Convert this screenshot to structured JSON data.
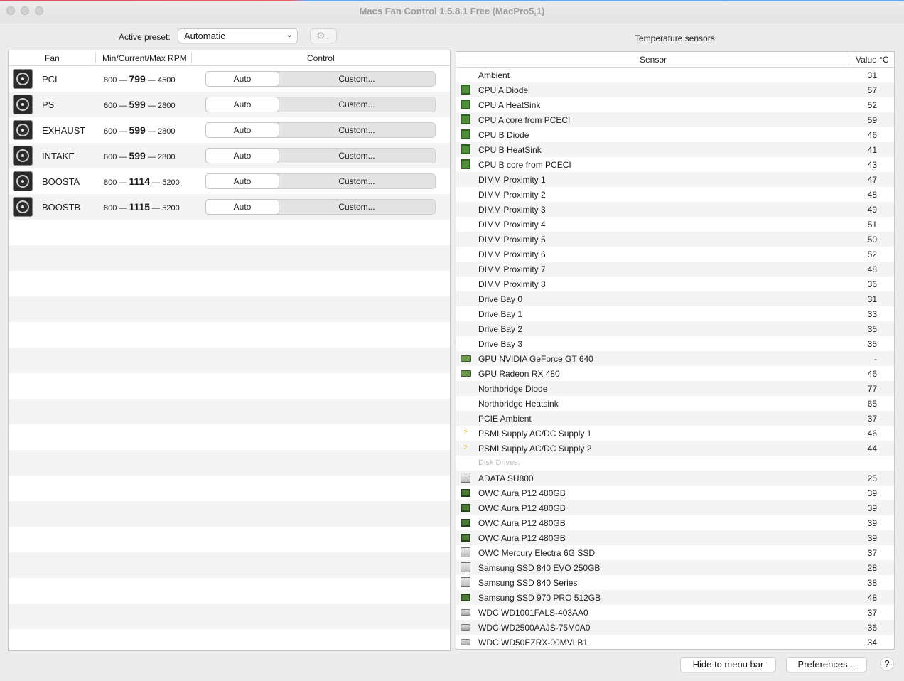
{
  "window": {
    "title": "Macs Fan Control 1.5.8.1 Free (MacPro5,1)"
  },
  "preset": {
    "label": "Active preset:",
    "value": "Automatic"
  },
  "fans_table": {
    "headers": {
      "fan": "Fan",
      "rpm": "Min/Current/Max RPM",
      "control": "Control"
    },
    "rows": [
      {
        "name": "PCI",
        "min": "800",
        "current": "799",
        "max": "4500",
        "auto": "Auto",
        "custom": "Custom..."
      },
      {
        "name": "PS",
        "min": "600",
        "current": "599",
        "max": "2800",
        "auto": "Auto",
        "custom": "Custom..."
      },
      {
        "name": "EXHAUST",
        "min": "600",
        "current": "599",
        "max": "2800",
        "auto": "Auto",
        "custom": "Custom..."
      },
      {
        "name": "INTAKE",
        "min": "600",
        "current": "599",
        "max": "2800",
        "auto": "Auto",
        "custom": "Custom..."
      },
      {
        "name": "BOOSTA",
        "min": "800",
        "current": "1114",
        "max": "5200",
        "auto": "Auto",
        "custom": "Custom..."
      },
      {
        "name": "BOOSTB",
        "min": "800",
        "current": "1115",
        "max": "5200",
        "auto": "Auto",
        "custom": "Custom..."
      }
    ]
  },
  "sensors": {
    "title": "Temperature sensors:",
    "headers": {
      "sensor": "Sensor",
      "value": "Value °C"
    },
    "rows": [
      {
        "name": "Ambient",
        "value": "31",
        "icon": "none"
      },
      {
        "name": "CPU A Diode",
        "value": "57",
        "icon": "chip"
      },
      {
        "name": "CPU A HeatSink",
        "value": "52",
        "icon": "chip"
      },
      {
        "name": "CPU A core from PCECI",
        "value": "59",
        "icon": "chip"
      },
      {
        "name": "CPU B Diode",
        "value": "46",
        "icon": "chip"
      },
      {
        "name": "CPU B HeatSink",
        "value": "41",
        "icon": "chip"
      },
      {
        "name": "CPU B core from PCECI",
        "value": "43",
        "icon": "chip"
      },
      {
        "name": "DIMM Proximity 1",
        "value": "47",
        "icon": "none"
      },
      {
        "name": "DIMM Proximity 2",
        "value": "48",
        "icon": "none"
      },
      {
        "name": "DIMM Proximity 3",
        "value": "49",
        "icon": "none"
      },
      {
        "name": "DIMM Proximity 4",
        "value": "51",
        "icon": "none"
      },
      {
        "name": "DIMM Proximity 5",
        "value": "50",
        "icon": "none"
      },
      {
        "name": "DIMM Proximity 6",
        "value": "52",
        "icon": "none"
      },
      {
        "name": "DIMM Proximity 7",
        "value": "48",
        "icon": "none"
      },
      {
        "name": "DIMM Proximity 8",
        "value": "36",
        "icon": "none"
      },
      {
        "name": "Drive Bay 0",
        "value": "31",
        "icon": "none"
      },
      {
        "name": "Drive Bay 1",
        "value": "33",
        "icon": "none"
      },
      {
        "name": "Drive Bay 2",
        "value": "35",
        "icon": "none"
      },
      {
        "name": "Drive Bay 3",
        "value": "35",
        "icon": "none"
      },
      {
        "name": "GPU NVIDIA GeForce GT 640",
        "value": "-",
        "icon": "gpu"
      },
      {
        "name": "GPU Radeon RX 480",
        "value": "46",
        "icon": "gpu"
      },
      {
        "name": "Northbridge Diode",
        "value": "77",
        "icon": "none"
      },
      {
        "name": "Northbridge Heatsink",
        "value": "65",
        "icon": "none"
      },
      {
        "name": "PCIE Ambient",
        "value": "37",
        "icon": "none"
      },
      {
        "name": "PSMI Supply AC/DC Supply 1",
        "value": "46",
        "icon": "power"
      },
      {
        "name": "PSMI Supply AC/DC Supply 2",
        "value": "44",
        "icon": "power"
      },
      {
        "name": "Disk Drives:",
        "value": "",
        "icon": "section"
      },
      {
        "name": "ADATA SU800",
        "value": "25",
        "icon": "disk"
      },
      {
        "name": "OWC Aura P12 480GB",
        "value": "39",
        "icon": "ssd"
      },
      {
        "name": "OWC Aura P12 480GB",
        "value": "39",
        "icon": "ssd"
      },
      {
        "name": "OWC Aura P12 480GB",
        "value": "39",
        "icon": "ssd"
      },
      {
        "name": "OWC Aura P12 480GB",
        "value": "39",
        "icon": "ssd"
      },
      {
        "name": "OWC Mercury Electra 6G SSD",
        "value": "37",
        "icon": "disk"
      },
      {
        "name": "Samsung SSD 840 EVO 250GB",
        "value": "28",
        "icon": "disk"
      },
      {
        "name": "Samsung SSD 840 Series",
        "value": "38",
        "icon": "disk"
      },
      {
        "name": "Samsung SSD 970 PRO 512GB",
        "value": "48",
        "icon": "ssd"
      },
      {
        "name": "WDC WD1001FALS-403AA0",
        "value": "37",
        "icon": "hdd"
      },
      {
        "name": "WDC WD2500AAJS-75M0A0",
        "value": "36",
        "icon": "hdd"
      },
      {
        "name": "WDC WD50EZRX-00MVLB1",
        "value": "34",
        "icon": "hdd"
      }
    ]
  },
  "footer": {
    "hide": "Hide to menu bar",
    "prefs": "Preferences...",
    "help": "?"
  }
}
